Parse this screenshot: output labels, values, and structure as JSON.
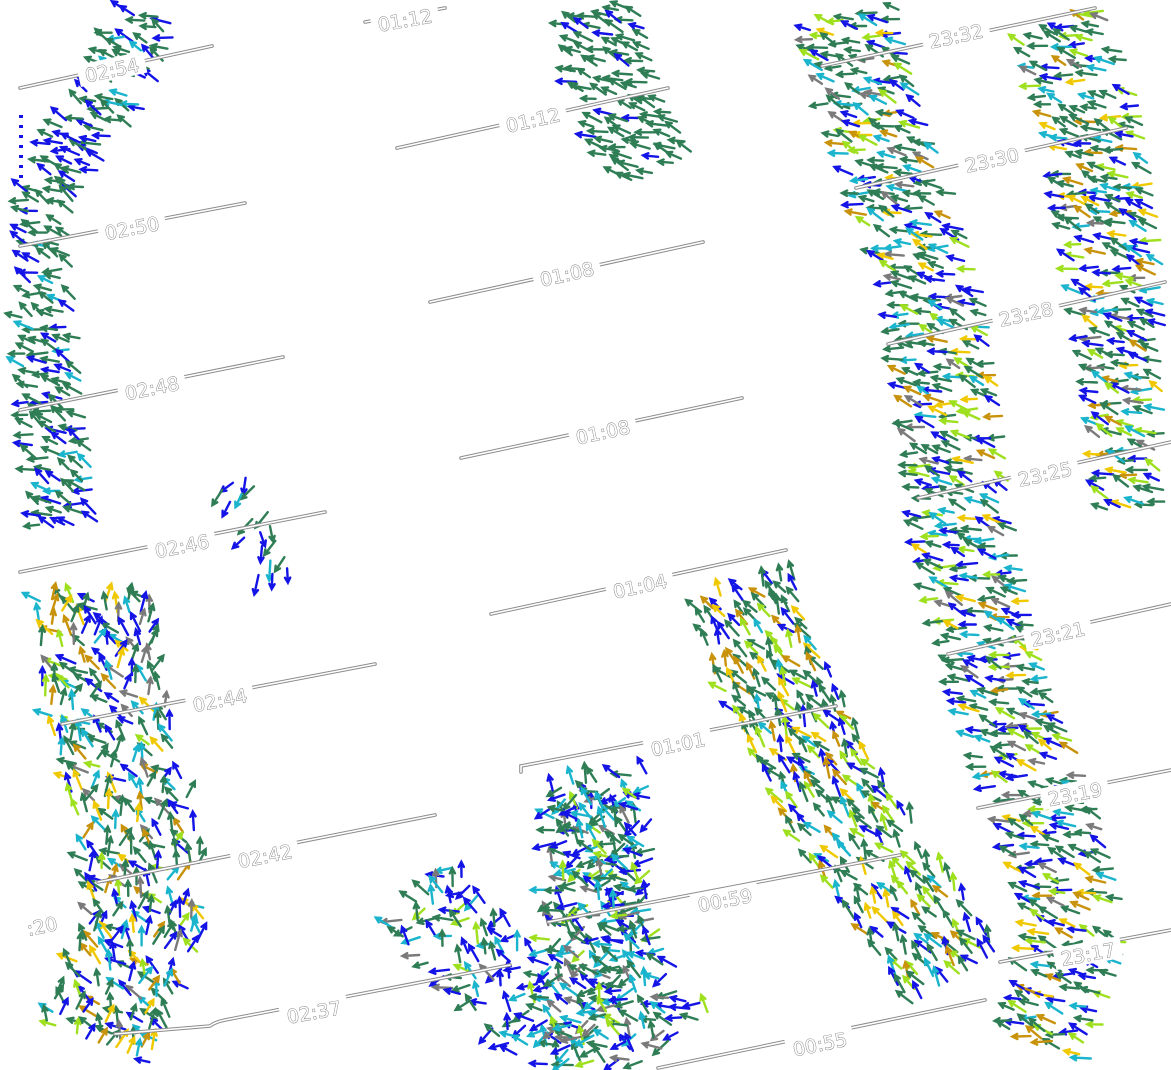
{
  "figure": {
    "background": "#ffffff",
    "legend": "none",
    "gridlines": false
  },
  "palette": {
    "dark_green": "#2e7d55",
    "blue": "#1414e6",
    "cyan": "#1ab4cc",
    "gray": "#7a7a7a",
    "dark_gray": "#3c3c3c",
    "lime": "#9ee01e",
    "gold": "#c8920a",
    "yellow": "#f0c800"
  },
  "swaths": [
    {
      "name": "left",
      "labels": [
        "02:54",
        "02:50",
        "02:48",
        "02:46",
        "02:44",
        "02:42",
        "02:37",
        ":20"
      ]
    },
    {
      "name": "center",
      "labels": [
        "01:12",
        "01:12",
        "01:08",
        "01:08",
        "01:04",
        "01:01",
        "00:59",
        "00:55"
      ]
    },
    {
      "name": "right",
      "labels": [
        "23:32",
        "23:30",
        "23:28",
        "23:25",
        "23:21",
        "23:19",
        "23:17"
      ]
    }
  ],
  "arrow_clusters": [
    {
      "name": "left-upper-strip",
      "colors": [
        "dark_green",
        "blue",
        "cyan"
      ]
    },
    {
      "name": "left-lower-strip",
      "colors": [
        "dark_green",
        "blue",
        "cyan",
        "gray",
        "lime",
        "gold",
        "yellow"
      ]
    },
    {
      "name": "small-isolated",
      "colors": [
        "blue",
        "dark_green",
        "cyan"
      ]
    },
    {
      "name": "center-top",
      "colors": [
        "dark_green",
        "blue"
      ]
    },
    {
      "name": "center-right-fan",
      "colors": [
        "dark_green",
        "blue",
        "cyan",
        "lime",
        "gold",
        "yellow"
      ]
    },
    {
      "name": "center-bottom",
      "colors": [
        "dark_green",
        "blue",
        "cyan",
        "lime",
        "gray"
      ]
    },
    {
      "name": "right-main-swath",
      "colors": [
        "dark_green",
        "blue",
        "cyan",
        "lime",
        "gold",
        "gray",
        "yellow"
      ]
    }
  ]
}
